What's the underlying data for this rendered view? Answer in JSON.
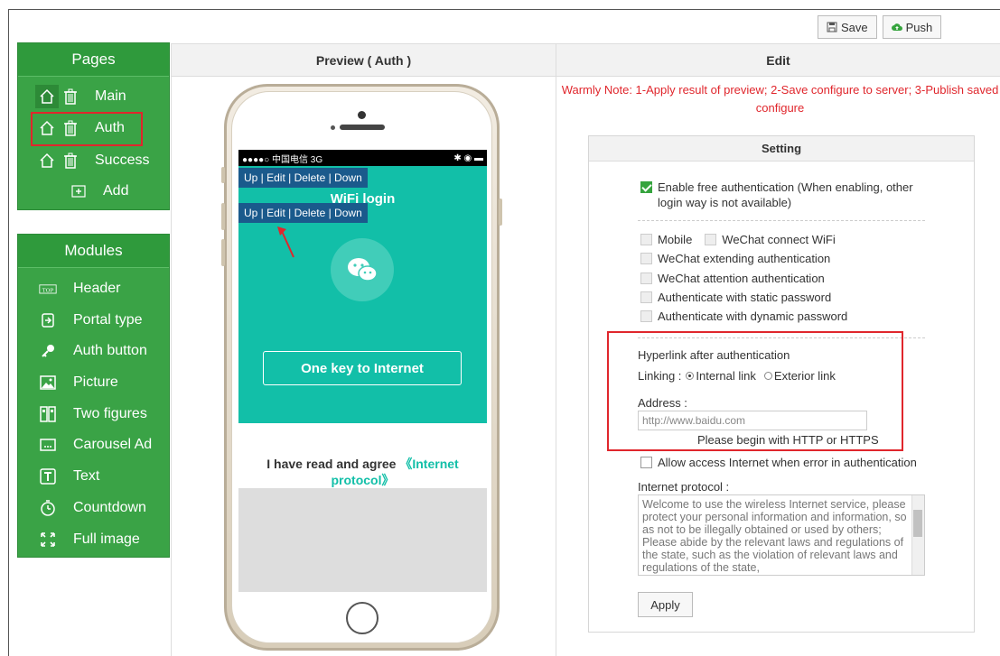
{
  "toolbar": {
    "save_label": "Save",
    "push_label": "Push"
  },
  "pages": {
    "title": "Pages",
    "items": [
      {
        "label": "Main"
      },
      {
        "label": "Auth"
      },
      {
        "label": "Success"
      }
    ],
    "add_label": "Add"
  },
  "modules": {
    "title": "Modules",
    "items": [
      {
        "label": "Header",
        "icon": "top-icon"
      },
      {
        "label": "Portal type",
        "icon": "login-icon"
      },
      {
        "label": "Auth button",
        "icon": "key-icon"
      },
      {
        "label": "Picture",
        "icon": "image-icon"
      },
      {
        "label": "Two figures",
        "icon": "two-figures-icon"
      },
      {
        "label": "Carousel Ad",
        "icon": "carousel-icon"
      },
      {
        "label": "Text",
        "icon": "text-icon"
      },
      {
        "label": "Countdown",
        "icon": "timer-icon"
      },
      {
        "label": "Full image",
        "icon": "fullscreen-icon"
      }
    ]
  },
  "preview": {
    "title": "Preview ( Auth )",
    "status": {
      "carrier": "●●●●○ 中国电信 3G",
      "right": "✱ ◉ ▬"
    },
    "login_title": "WiFi login",
    "module_toolbar": "Up | Edit | Delete | Down",
    "button_label": "One key to Internet",
    "agree_text": "I have read and agree ",
    "agree_link": "《Internet protocol》"
  },
  "edit": {
    "title": "Edit",
    "note": "Warmly Note: 1-Apply result of preview; 2-Save configure to server; 3-Publish saved configure",
    "setting_title": "Setting",
    "enable_free": "Enable free authentication  (When enabling, other login way is not available)",
    "mobile": "Mobile",
    "wechat_wifi": "WeChat connect WiFi",
    "wechat_extend": "WeChat extending authentication",
    "wechat_attention": "WeChat attention authentication",
    "static_pwd": "Authenticate with static password",
    "dynamic_pwd": "Authenticate with dynamic password",
    "hyperlink_title": "Hyperlink after authentication",
    "linking_label": "Linking :",
    "internal_link": "Internal link",
    "exterior_link": "Exterior link",
    "address_label": "Address :",
    "address_placeholder": "http://www.baidu.com",
    "address_hint": "Please begin with HTTP or HTTPS",
    "allow_error": "Allow access Internet when error in authentication",
    "protocol_label": "Internet protocol :",
    "protocol_text": "Welcome to use the wireless Internet service, please protect your personal information and information, so as not to be illegally obtained or used by others; Please abide by the relevant laws and regulations of the state, such as the violation of relevant laws and regulations of the state,",
    "apply_label": "Apply"
  },
  "colors": {
    "accent": "#3aa346",
    "teal": "#12bfa8",
    "note_red": "#e0262c"
  }
}
